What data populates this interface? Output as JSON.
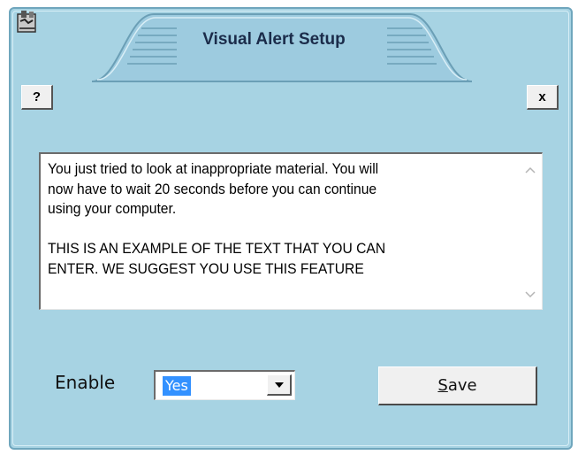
{
  "window": {
    "title": "Visual Alert Setup",
    "icons": {
      "app": "app-logo-icon",
      "dropdown": "triangle-down-icon",
      "scroll_up": "chevron-up-icon",
      "scroll_down": "chevron-down-icon"
    },
    "help_label": "?",
    "close_label": "x"
  },
  "message": {
    "text": "You just tried to look at inappropriate material. You will\nnow have to wait 20 seconds before you can continue\nusing your computer.\n\nTHIS IS AN EXAMPLE OF THE TEXT THAT YOU CAN\nENTER.  WE SUGGEST YOU USE THIS FEATURE"
  },
  "enable": {
    "label": "Enable",
    "selected": "Yes"
  },
  "save": {
    "mnemonic": "S",
    "rest": "ave"
  },
  "colors": {
    "window_bg": "#a7d3e3",
    "title_tab_bg": "#9dcbdf",
    "selection": "#3391ff"
  }
}
